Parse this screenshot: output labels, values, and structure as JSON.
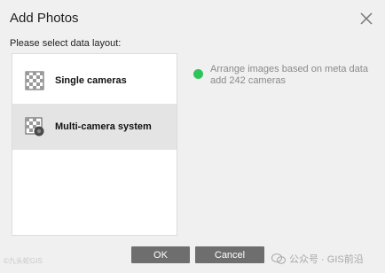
{
  "dialog": {
    "title": "Add Photos",
    "close_icon": "close-icon",
    "subtitle": "Please select data layout:"
  },
  "layouts": [
    {
      "label": "Single cameras",
      "icon": "checker-pattern-icon",
      "selected": false
    },
    {
      "label": "Multi-camera system",
      "icon": "checker-camera-icon",
      "selected": true
    }
  ],
  "option": {
    "status_color": "#2ec45a",
    "text": "Arrange images based on meta data add 242 cameras"
  },
  "buttons": {
    "ok": "OK",
    "cancel": "Cancel"
  },
  "watermarks": {
    "left": "©九头蛇GIS",
    "right": "公众号 · GIS前沿"
  }
}
